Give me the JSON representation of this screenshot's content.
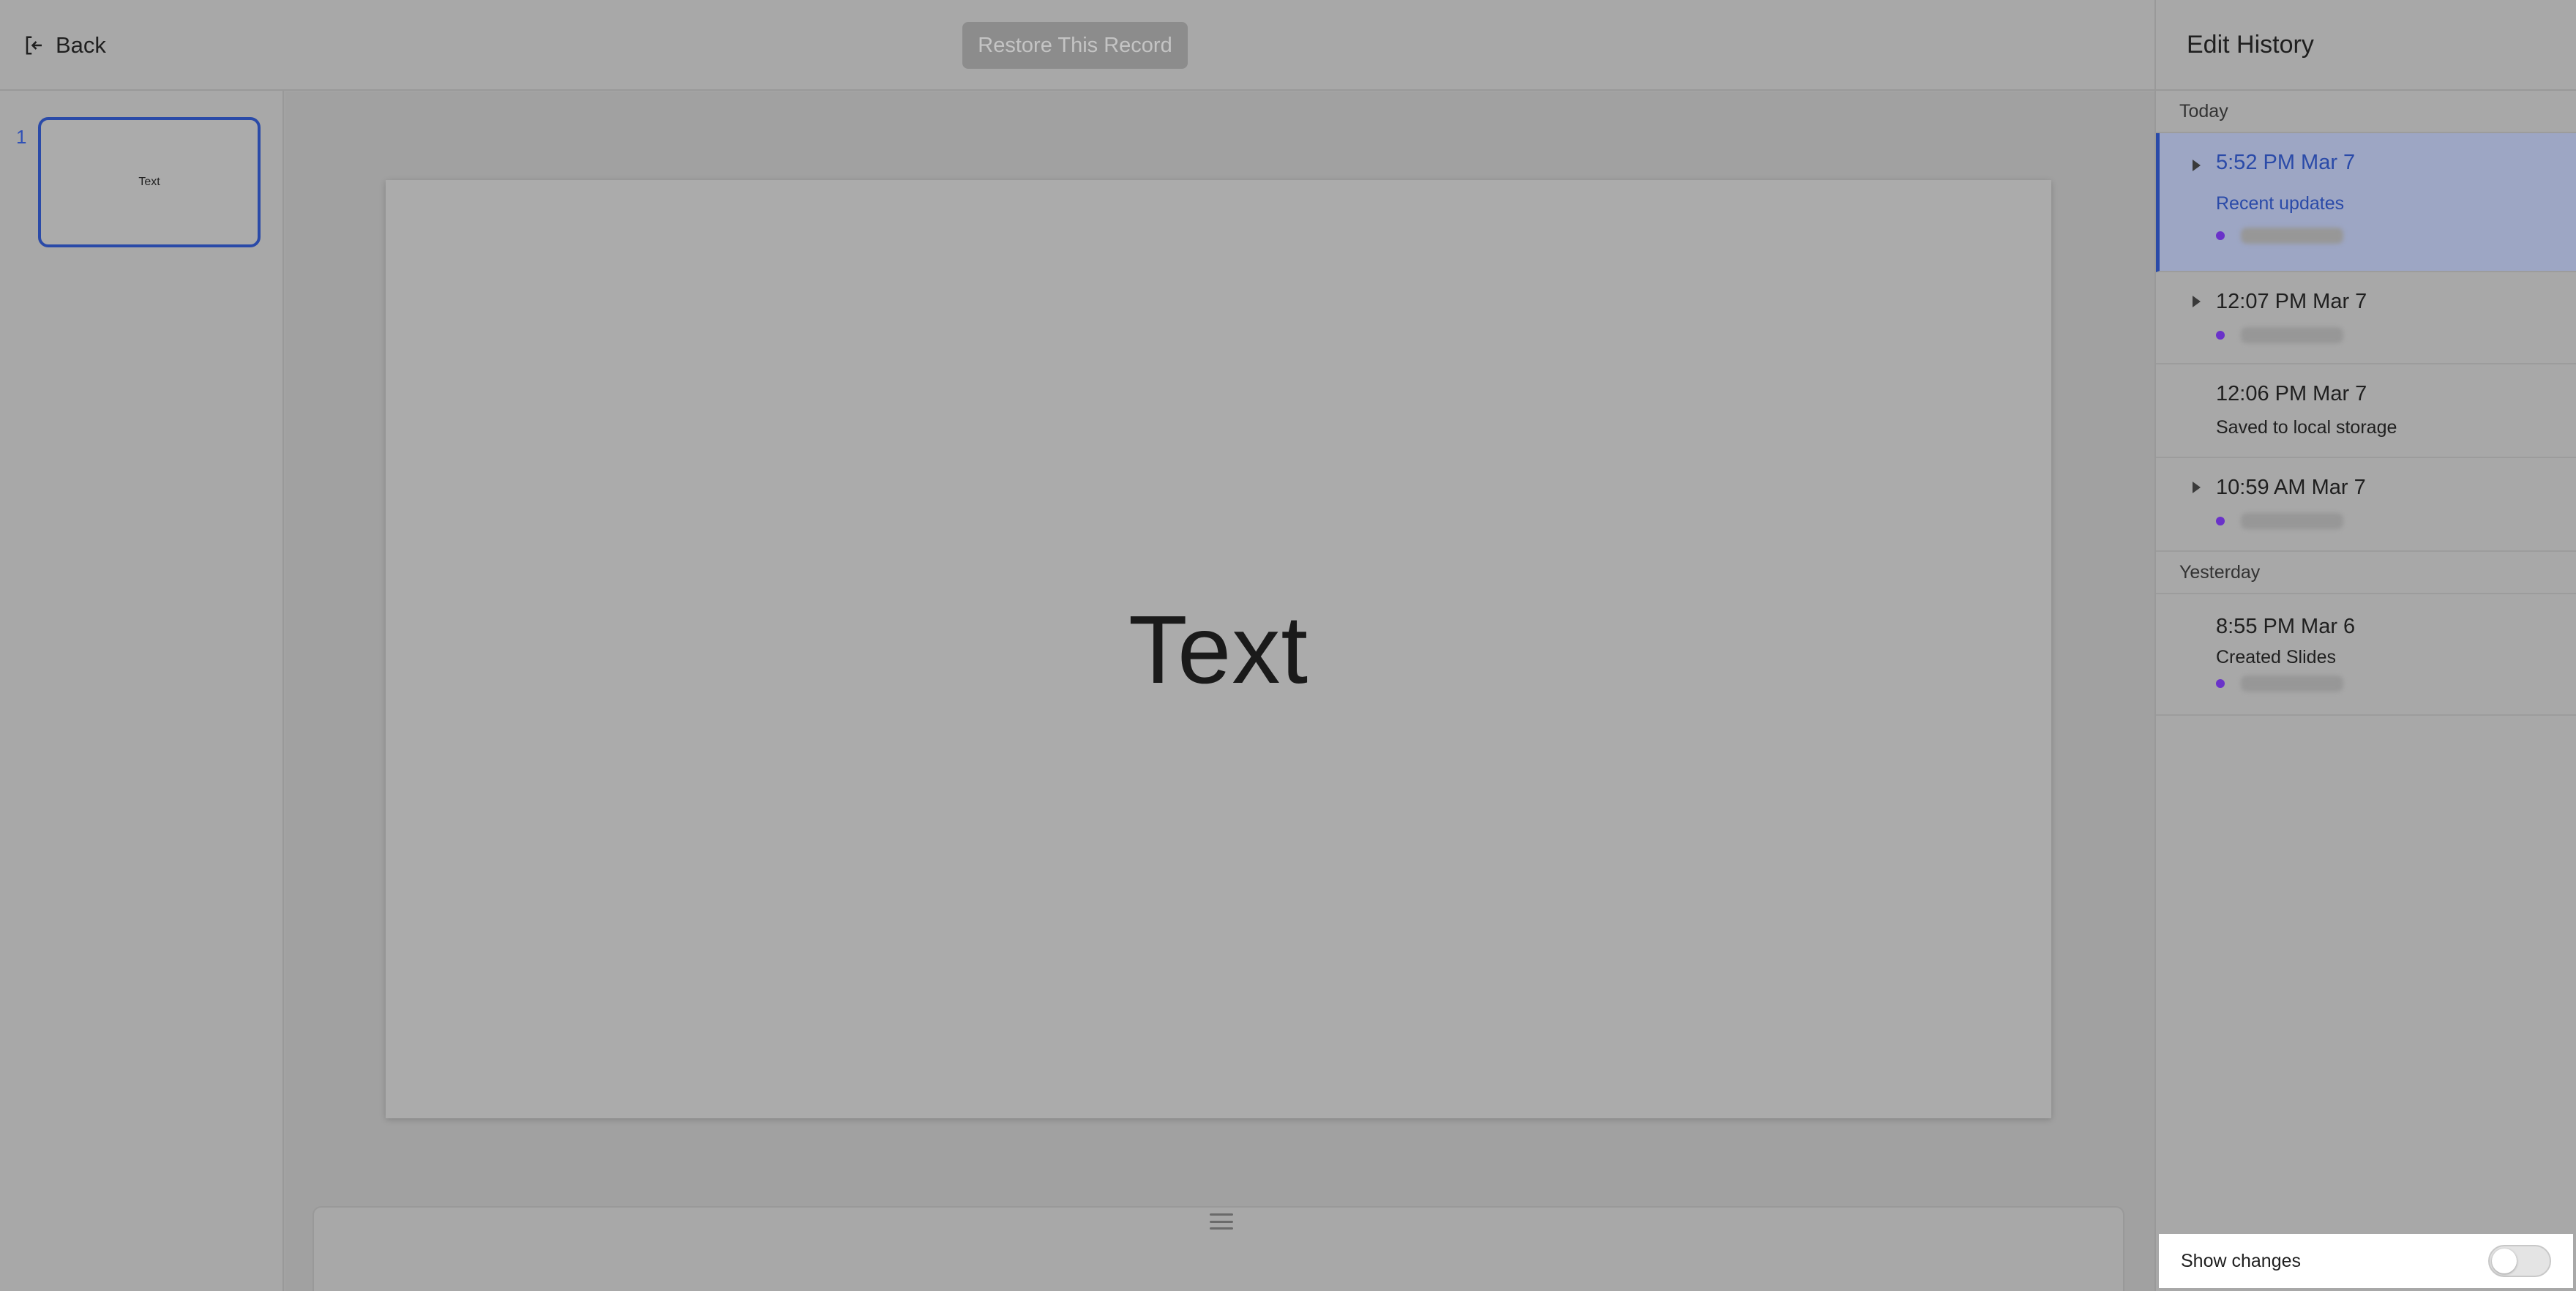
{
  "topbar": {
    "back_label": "Back",
    "back_icon": "exit-icon",
    "restore_label": "Restore This Record"
  },
  "thumbnails": [
    {
      "number": "1",
      "text": "Text"
    }
  ],
  "slide": {
    "text": "Text"
  },
  "history": {
    "title": "Edit History",
    "groups": [
      {
        "label": "Today",
        "entries": [
          {
            "time": "5:52 PM Mar 7",
            "desc": "Recent updates",
            "selected": true,
            "expandable": true
          },
          {
            "time": "12:07 PM Mar 7",
            "desc": "",
            "expandable": true
          },
          {
            "time": "12:06 PM Mar 7",
            "desc": "Saved to local storage",
            "expandable": false
          },
          {
            "time": "10:59 AM Mar 7",
            "desc": "",
            "expandable": true
          }
        ]
      },
      {
        "label": "Yesterday",
        "entries": [
          {
            "time": "8:55 PM Mar 6",
            "desc": "Created Slides",
            "expandable": false
          }
        ]
      }
    ],
    "show_changes_label": "Show changes",
    "show_changes_on": false
  },
  "colors": {
    "accent": "#2a4aa8",
    "user_dot": "#6a32c9"
  }
}
